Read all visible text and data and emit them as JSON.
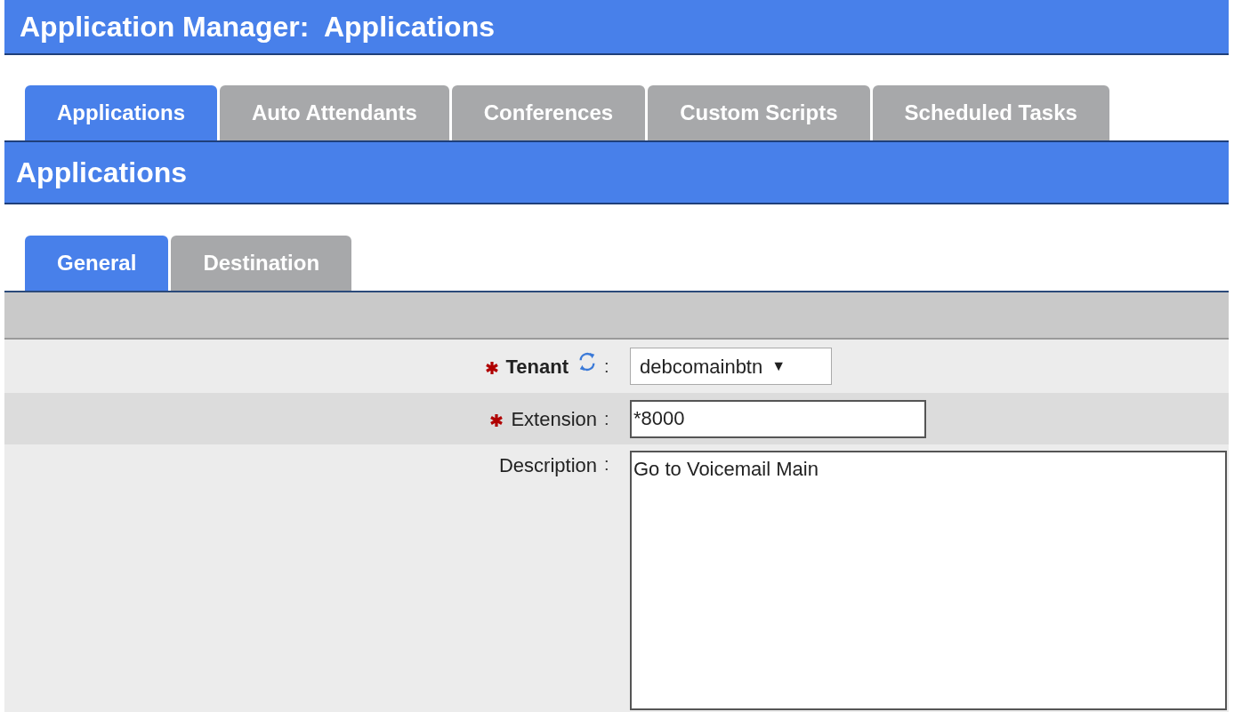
{
  "header": {
    "title": "Application Manager:  Applications"
  },
  "tabs": [
    {
      "label": "Applications",
      "selected": true
    },
    {
      "label": "Auto Attendants",
      "selected": false
    },
    {
      "label": "Conferences",
      "selected": false
    },
    {
      "label": "Custom Scripts",
      "selected": false
    },
    {
      "label": "Scheduled Tasks",
      "selected": false
    }
  ],
  "section": {
    "title": "Applications"
  },
  "subtabs": [
    {
      "label": "General",
      "selected": true
    },
    {
      "label": "Destination",
      "selected": false
    }
  ],
  "fields": [
    {
      "kind": "select",
      "label": "Tenant",
      "required": true,
      "separator": ":",
      "value": "debcomainbtn",
      "arrow": "▼"
    },
    {
      "kind": "text",
      "label": "Extension",
      "required": true,
      "separator": ":",
      "value": "*8000"
    },
    {
      "kind": "textarea",
      "label": "Description",
      "required": false,
      "separator": ":",
      "value": "Go to Voicemail Main"
    }
  ]
}
